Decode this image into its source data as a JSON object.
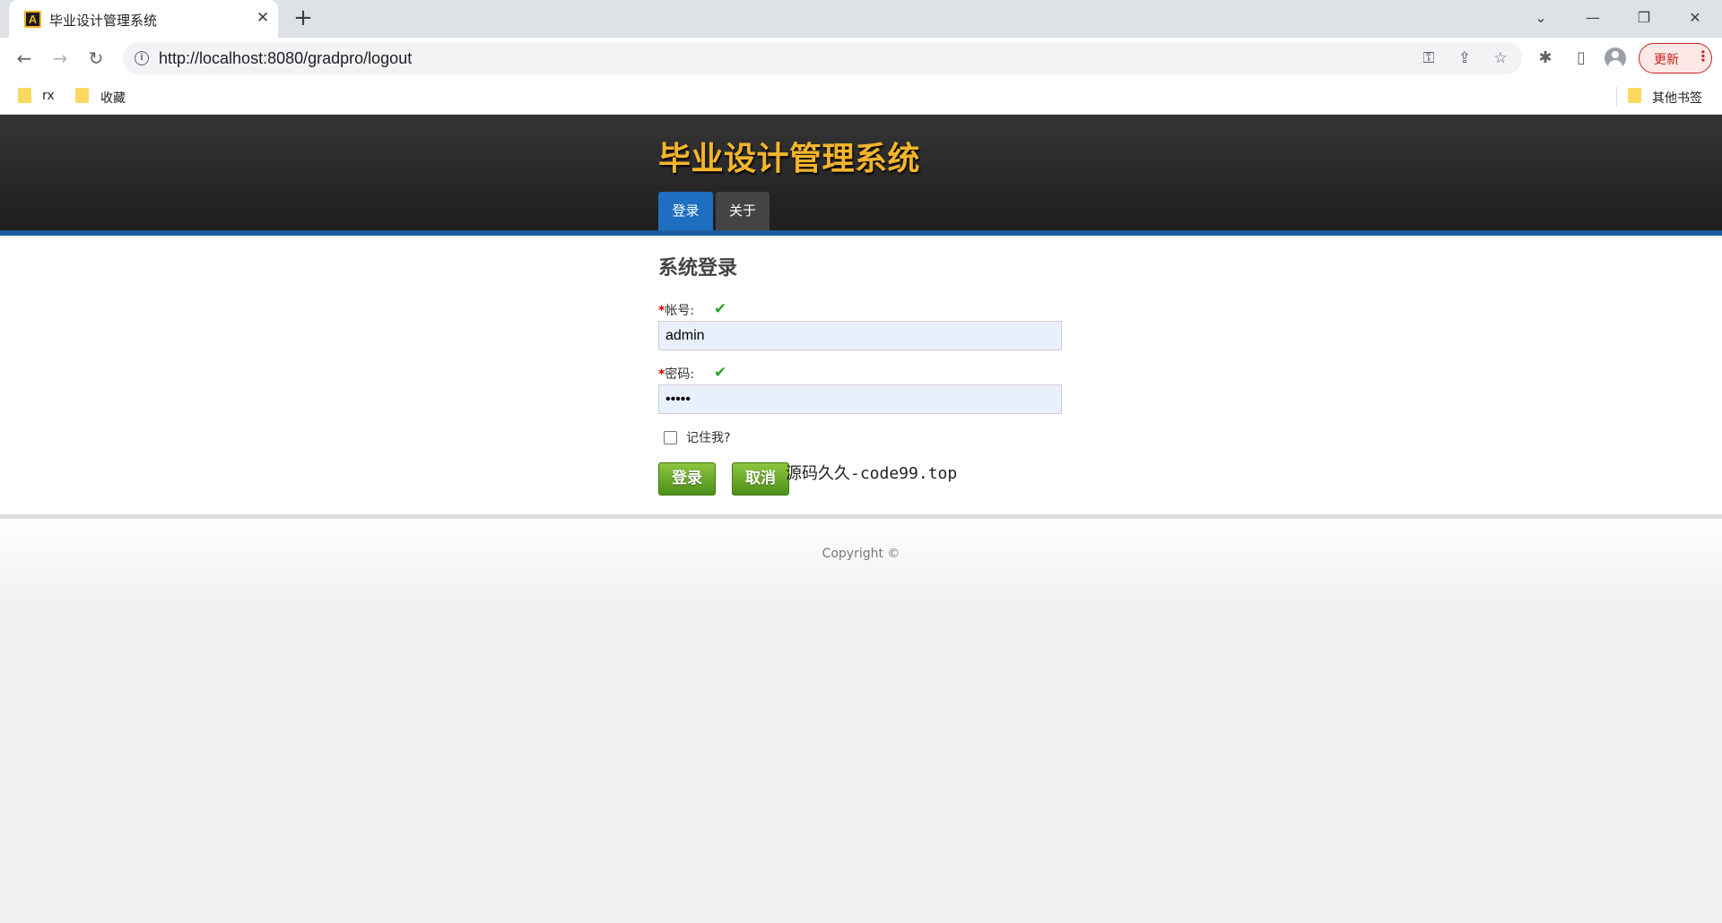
{
  "browser": {
    "tab_title": "毕业设计管理系统",
    "url": "http://localhost:8080/gradpro/logout",
    "update_label": "更新",
    "bookmarks": [
      {
        "label": "rx"
      },
      {
        "label": "收藏"
      }
    ],
    "other_bookmarks_label": "其他书签"
  },
  "site": {
    "title": "毕业设计管理系统",
    "nav": [
      {
        "label": "登录",
        "active": true
      },
      {
        "label": "关于",
        "active": false
      }
    ]
  },
  "login_form": {
    "title": "系统登录",
    "required_mark": "*",
    "account_label": "帐号:",
    "account_value": "admin",
    "password_label": "密码:",
    "password_value": "•••••",
    "remember_label": "记住我?",
    "remember_checked": false,
    "login_button": "登录",
    "cancel_button": "取消"
  },
  "watermark": "源码久久-code99.top",
  "footer": {
    "copyright": "Copyright ©"
  },
  "colors": {
    "title_yellow": "#f4b52b",
    "nav_active": "#1e6fc0",
    "accent_rule": "#1d5c9e",
    "button_green": "#6aa62c",
    "check_green": "#2aa32a",
    "required_red": "#d00000"
  }
}
